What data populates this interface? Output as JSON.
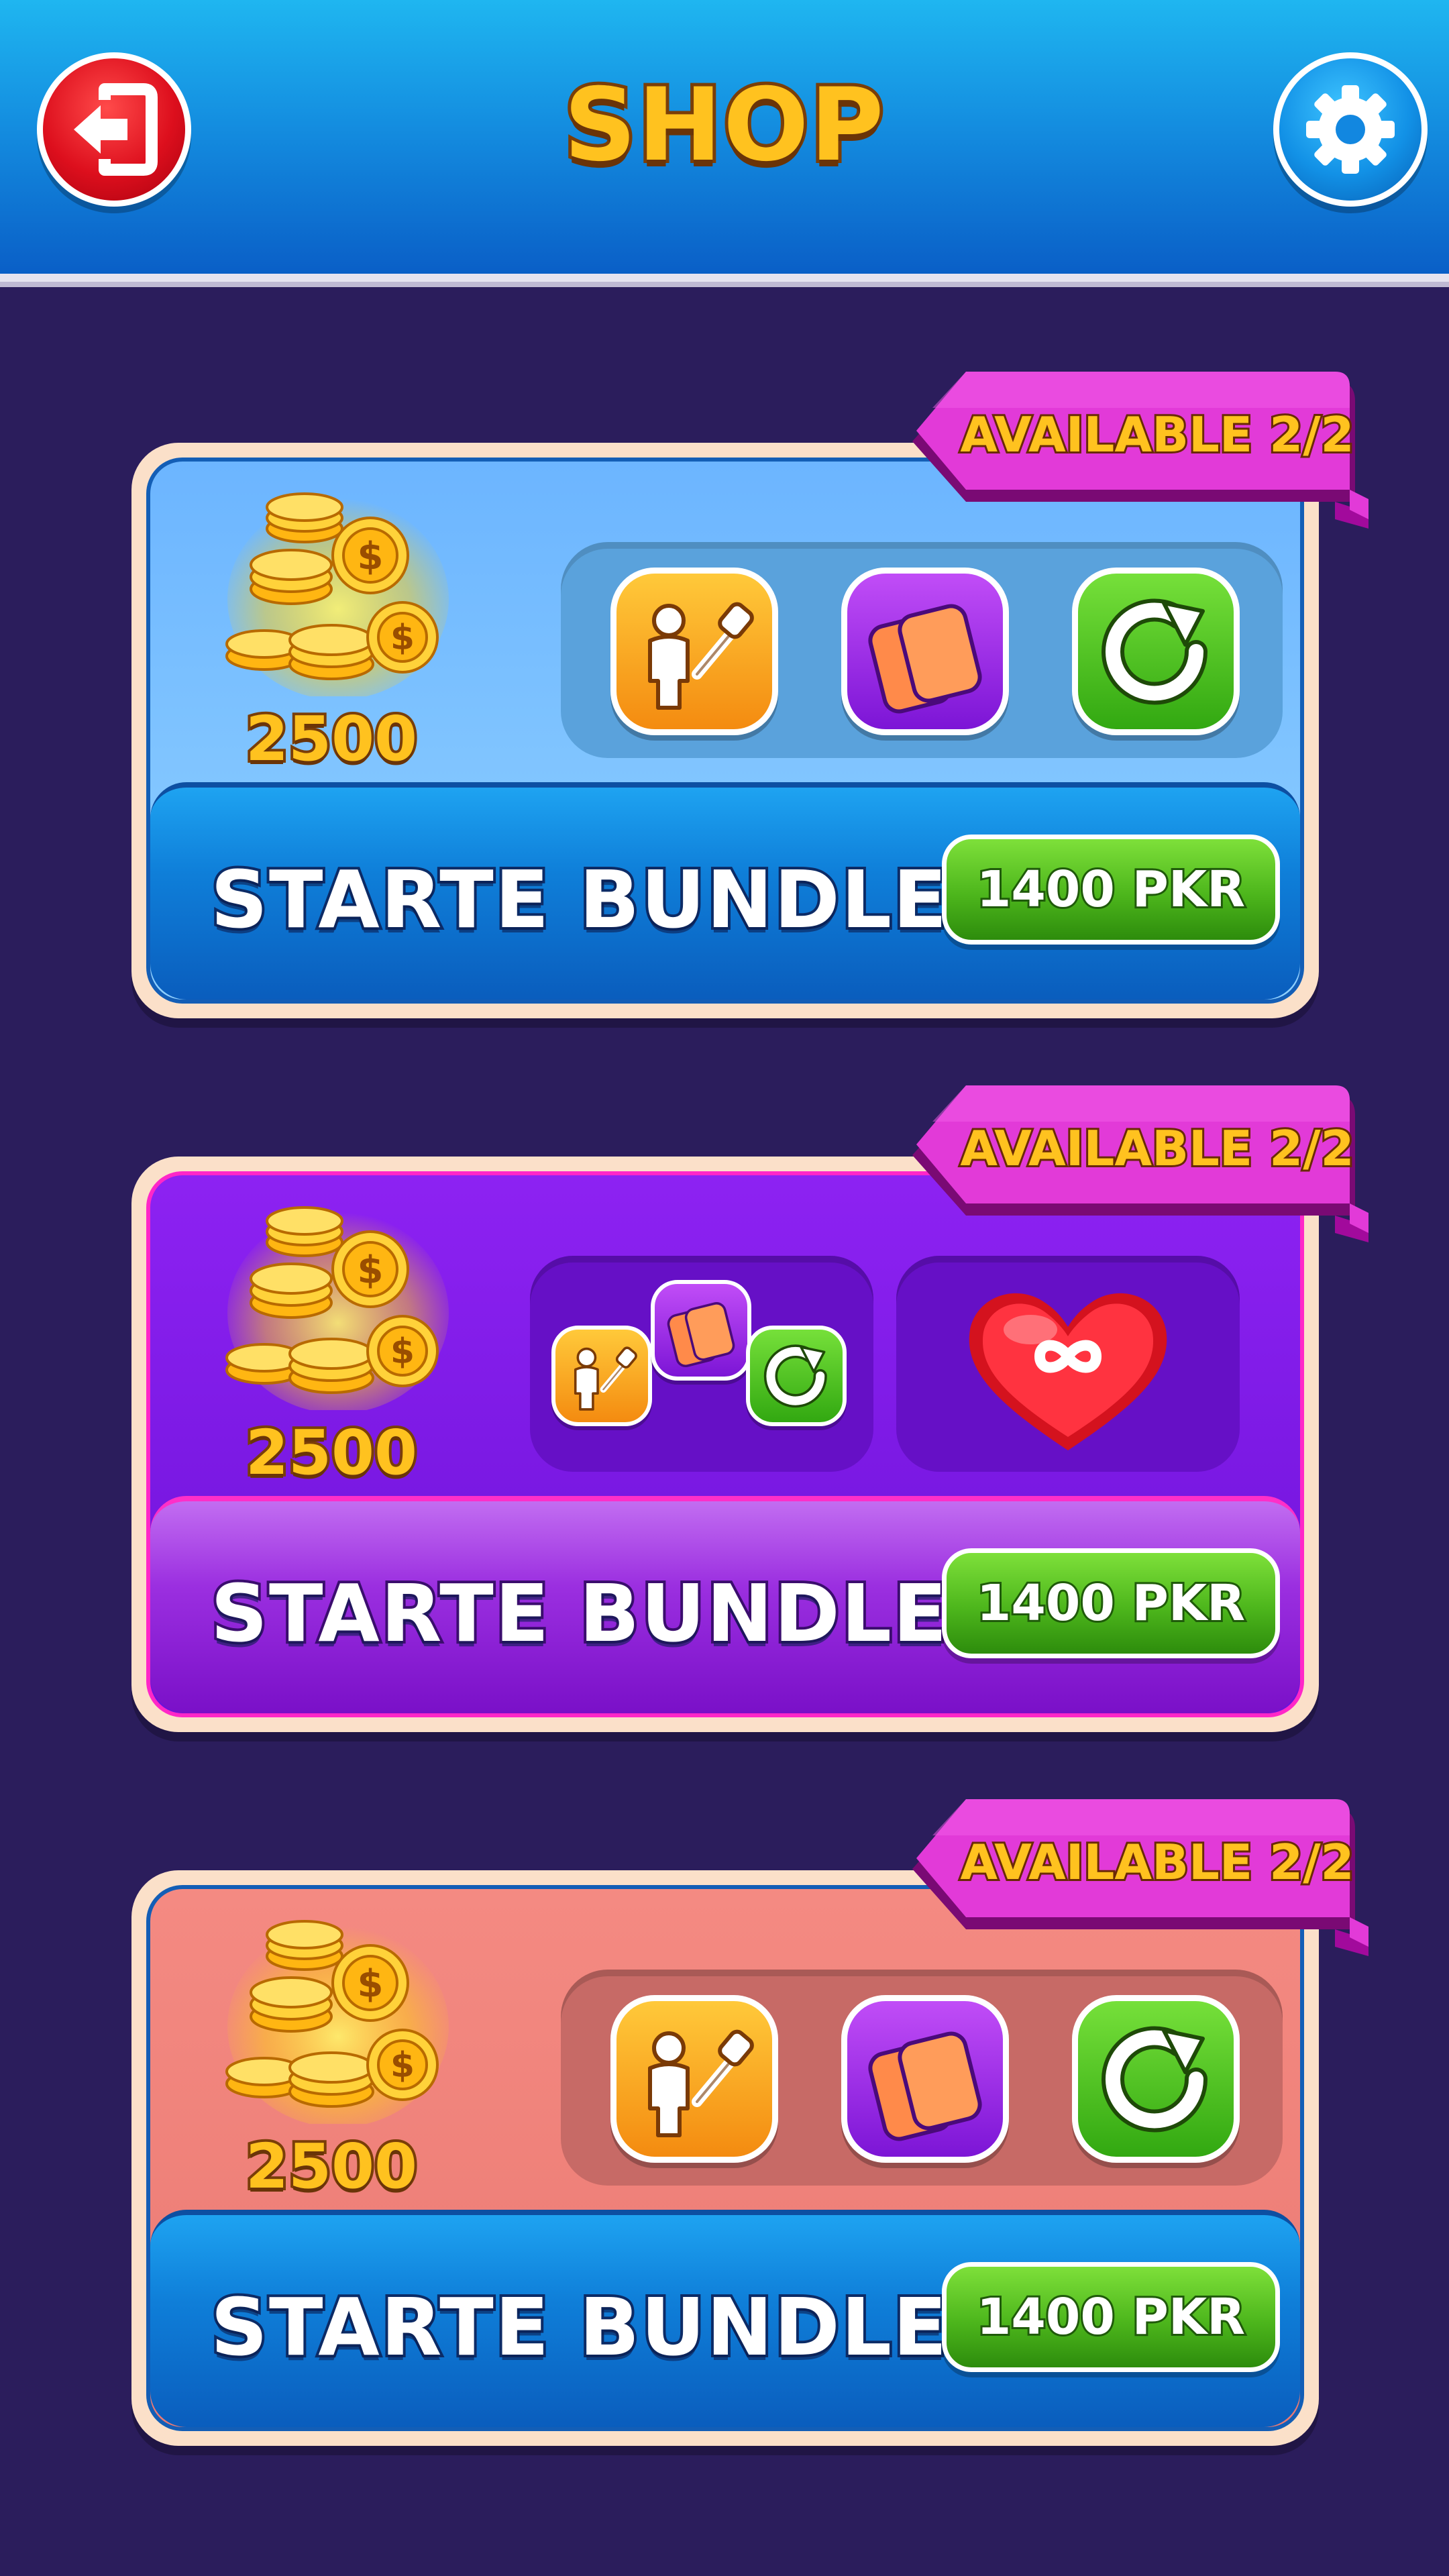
{
  "header": {
    "title": "SHOP",
    "exit_icon": "exit-icon",
    "settings_icon": "gear-icon"
  },
  "bundles": [
    {
      "theme": "blue",
      "availability": "AVAILABLE  2/2",
      "coins": "2500",
      "items": [
        "avatar-color-picker-icon",
        "cards-icon",
        "refresh-icon"
      ],
      "title": "STARTE BUNDLE",
      "price": "1400 PKR"
    },
    {
      "theme": "purple",
      "availability": "AVAILABLE  2/2",
      "coins": "2500",
      "items": [
        "avatar-color-picker-icon",
        "cards-icon",
        "refresh-icon",
        "infinite-lives-heart-icon"
      ],
      "title": "STARTE BUNDLE",
      "price": "1400 PKR"
    },
    {
      "theme": "red",
      "availability": "AVAILABLE  2/2",
      "coins": "2500",
      "items": [
        "avatar-color-picker-icon",
        "cards-icon",
        "refresh-icon"
      ],
      "title": "STARTE BUNDLE",
      "price": "1400 PKR"
    }
  ],
  "colors": {
    "header_top": "#1fb6f0",
    "background": "#2b1d5c",
    "coin_text": "#ffc21f",
    "price_button": "#4db61c",
    "ribbon": "#e23ad8"
  }
}
